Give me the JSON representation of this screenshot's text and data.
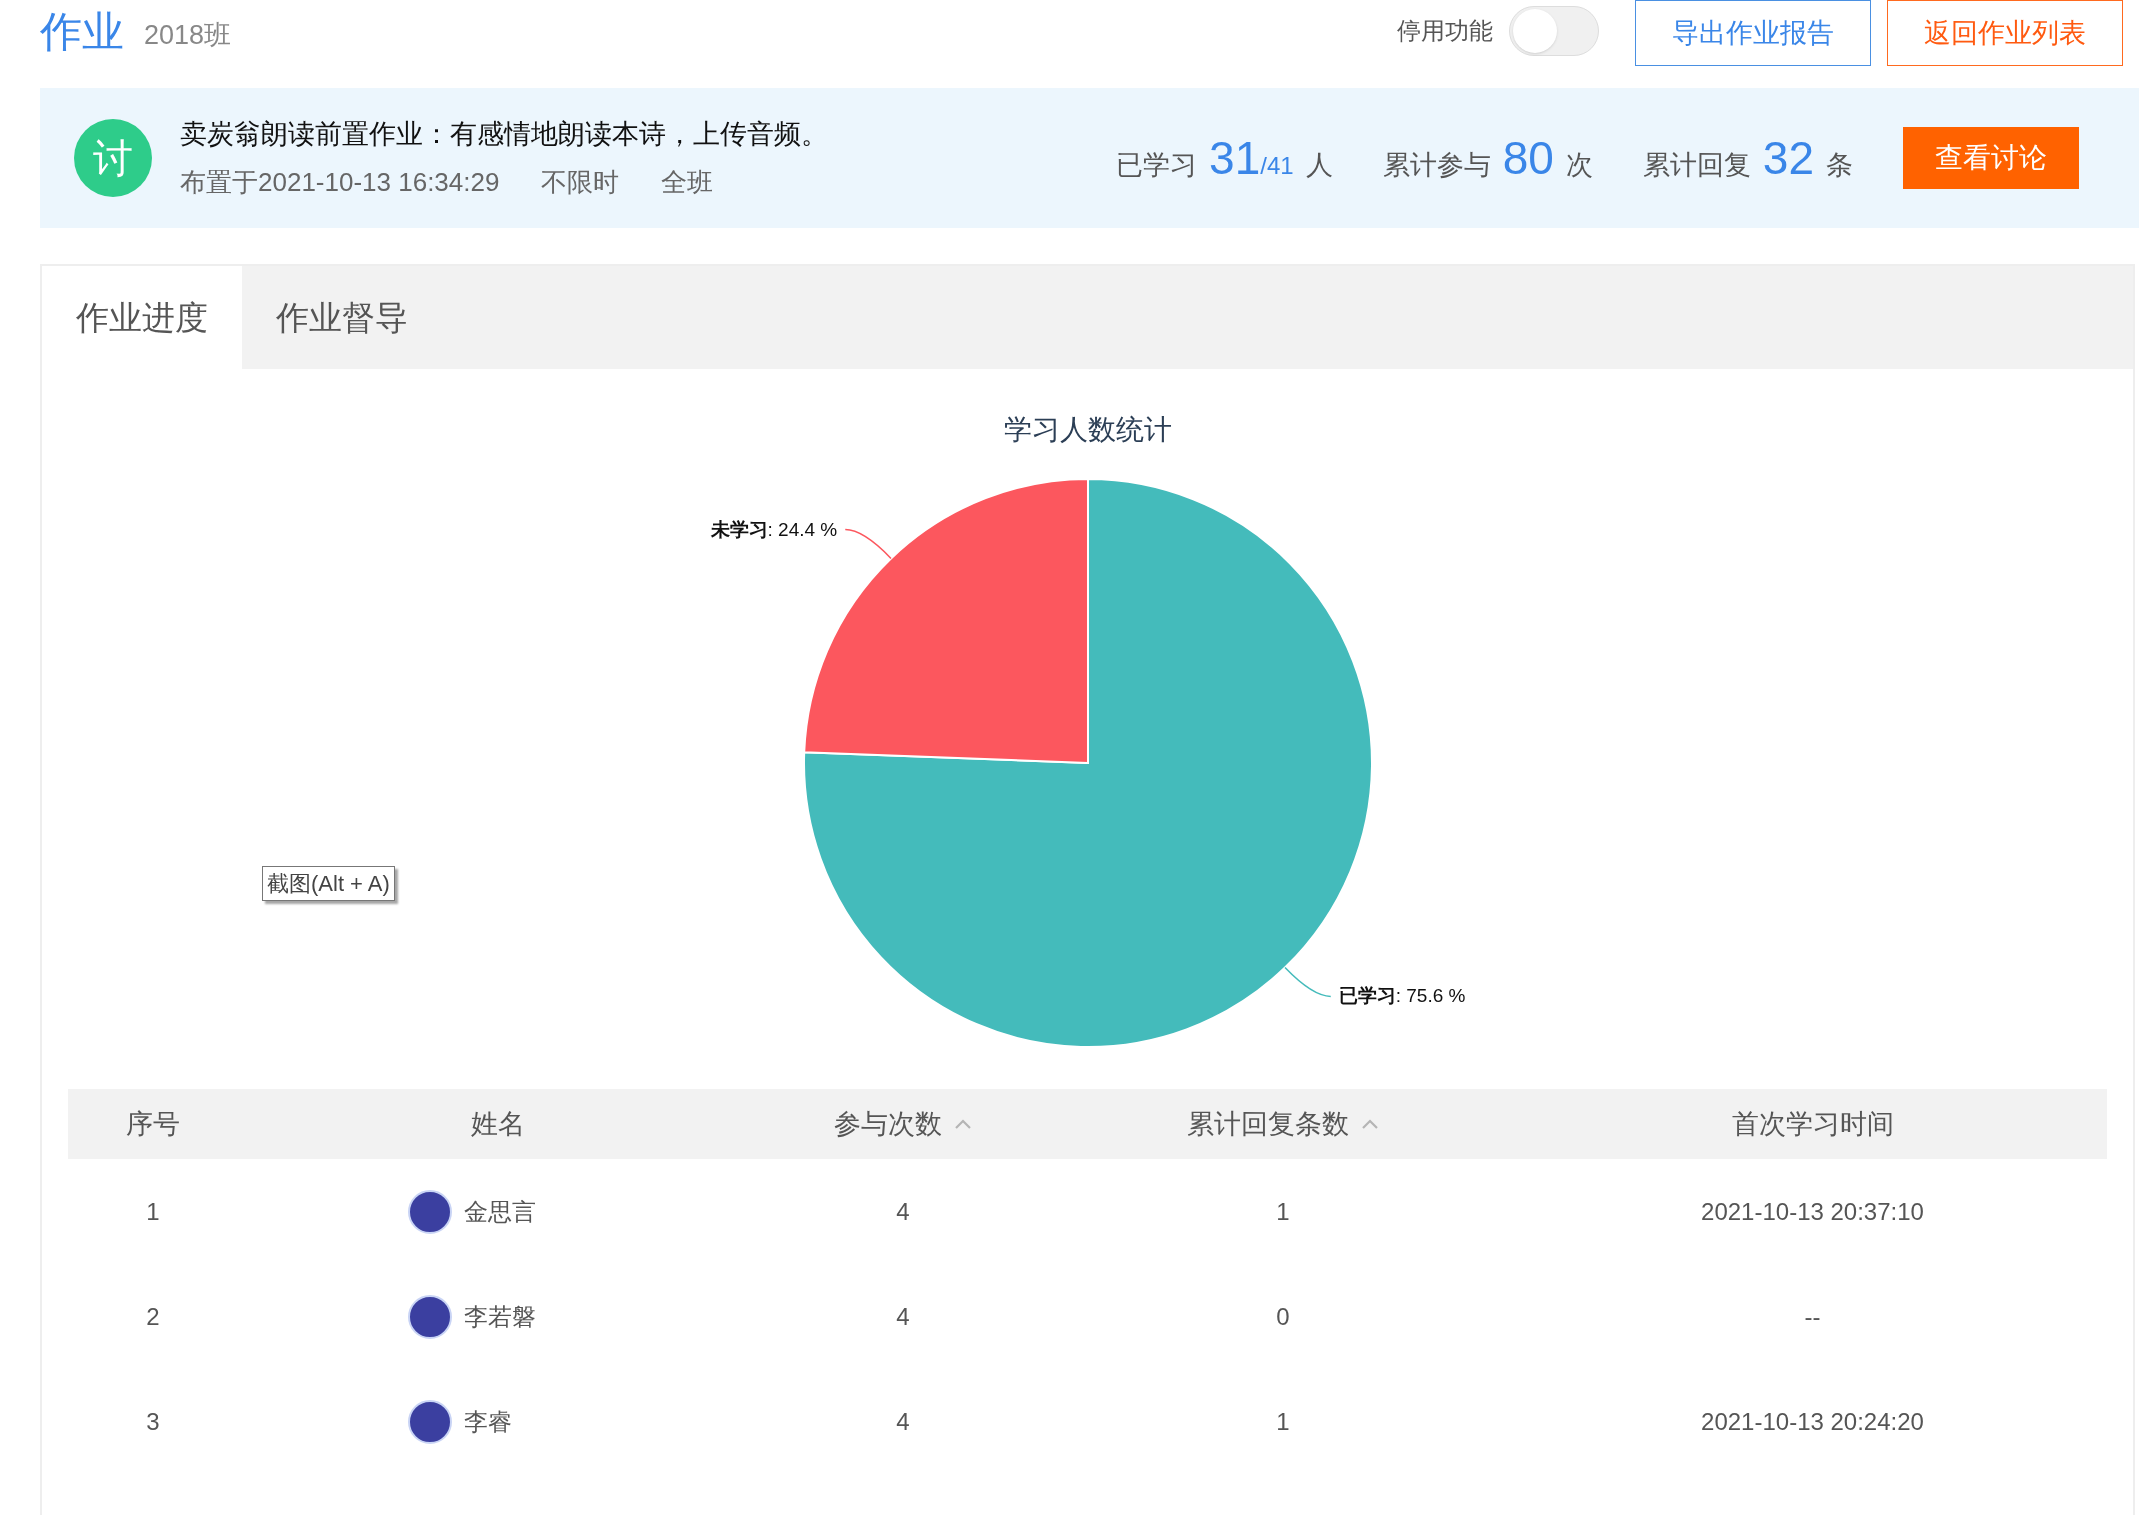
{
  "header": {
    "title": "作业",
    "class_name": "2018班",
    "toggle": {
      "label": "停用功能",
      "on": false
    },
    "buttons": [
      {
        "label": "导出作业报告",
        "kind": "outline-blue"
      },
      {
        "label": "返回作业列表",
        "kind": "outline-orange"
      }
    ]
  },
  "banner": {
    "icon_text": "讨",
    "title": "卖炭翁朗读前置作业：有感情地朗读本诗，上传音频。",
    "meta": [
      "布置于2021-10-13 16:34:29",
      "不限时",
      "全班"
    ],
    "stats": [
      {
        "label": "已学习",
        "value": "31",
        "total": "/41",
        "unit": "人"
      },
      {
        "label": "累计参与",
        "value": "80",
        "unit": "次"
      },
      {
        "label": "累计回复",
        "value": "32",
        "unit": "条"
      }
    ],
    "button": "查看讨论"
  },
  "tabs": [
    {
      "label": "作业进度",
      "selected": true
    },
    {
      "label": "作业督导",
      "selected": false
    }
  ],
  "chart": {
    "chart_data": {
      "type": "pie",
      "title": "学习人数统计",
      "categories": [
        "已学习",
        "未学习"
      ],
      "values": [
        75.6,
        24.4
      ],
      "colors": [
        "#44bbbb",
        "#fc575e"
      ],
      "value_labels": [
        ": 75.6 %",
        ": 24.4 %"
      ]
    }
  },
  "tooltip": "截图(Alt + A)",
  "table": {
    "columns": [
      {
        "label": "序号",
        "sortable": false
      },
      {
        "label": "姓名",
        "sortable": false
      },
      {
        "label": "参与次数",
        "sortable": true
      },
      {
        "label": "累计回复条数",
        "sortable": true
      },
      {
        "label": "首次学习时间",
        "sortable": false
      }
    ],
    "rows": [
      [
        "1",
        "金思言",
        "4",
        "1",
        "2021-10-13 20:37:10"
      ],
      [
        "2",
        "李若磐",
        "4",
        "0",
        "--"
      ],
      [
        "3",
        "李睿",
        "4",
        "1",
        "2021-10-13 20:24:20"
      ]
    ]
  }
}
